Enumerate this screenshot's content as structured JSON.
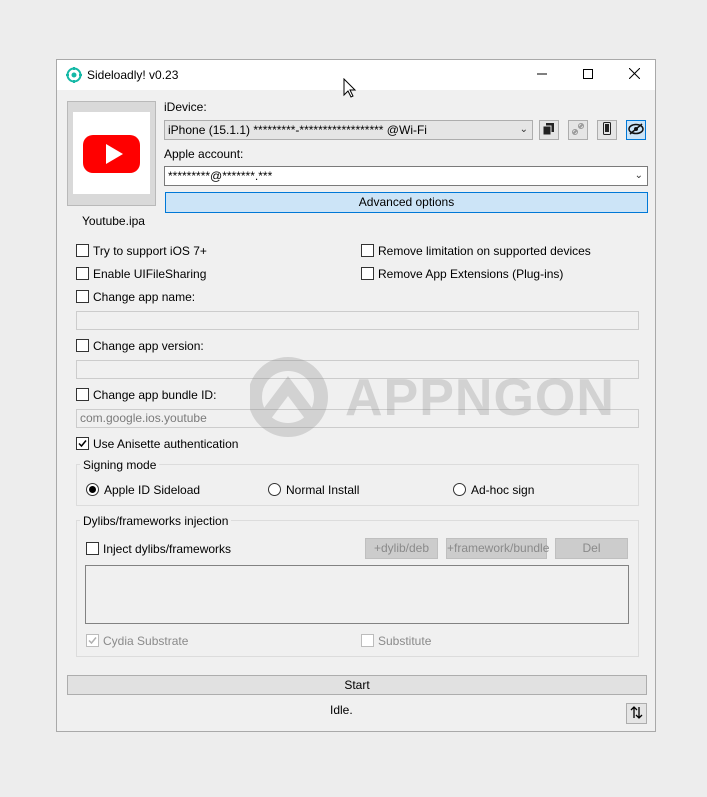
{
  "window": {
    "title": "Sideloadly! v0.23",
    "controls": {
      "minimize": "minimize-icon",
      "maximize": "maximize-icon",
      "close": "close-icon"
    }
  },
  "app": {
    "icon": "youtube-icon",
    "filename": "Youtube.ipa"
  },
  "device": {
    "label": "iDevice:",
    "value": "iPhone (15.1.1) *********-****************** @Wi-Fi",
    "buttons": [
      "copy-icon",
      "broken-link-icon",
      "phone-icon",
      "eye-hidden-icon"
    ]
  },
  "account": {
    "label": "Apple account:",
    "value": "*********@*******.***"
  },
  "advanced_label": "Advanced options",
  "options": {
    "ios7": "Try to support iOS 7+",
    "remove_limit": "Remove limitation on supported devices",
    "filesharing": "Enable UIFileSharing",
    "remove_ext": "Remove App Extensions (Plug-ins)",
    "change_name": "Change app name:",
    "change_version": "Change app version:",
    "change_bundle": "Change app bundle ID:",
    "bundle_placeholder": "com.google.ios.youtube",
    "anisette": "Use Anisette authentication"
  },
  "signing": {
    "title": "Signing mode",
    "modes": [
      "Apple ID Sideload",
      "Normal Install",
      "Ad-hoc sign"
    ],
    "selected": "Apple ID Sideload"
  },
  "dylibs": {
    "title": "Dylibs/frameworks injection",
    "inject": "Inject dylibs/frameworks",
    "add_dylib": "+dylib/deb",
    "add_framework": "+framework/bundle",
    "del": "Del",
    "cydia": "Cydia Substrate",
    "substitute": "Substitute"
  },
  "start_label": "Start",
  "status": "Idle.",
  "watermark": "APPNGON"
}
